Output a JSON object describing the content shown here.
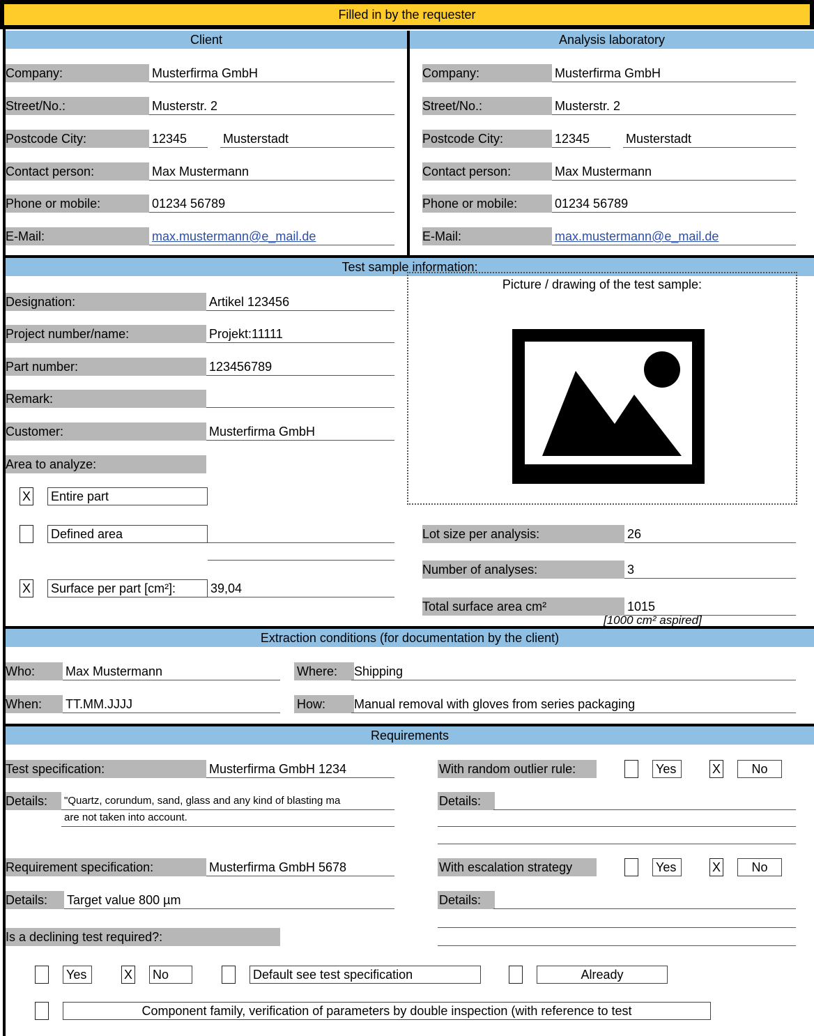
{
  "header": {
    "title": "Filled in by the requester"
  },
  "client": {
    "title": "Client",
    "company_label": "Company:",
    "company": "Musterfirma GmbH",
    "street_label": "Street/No.:",
    "street": "Musterstr. 2",
    "postcode_label": "Postcode City:",
    "postcode": "12345",
    "city": "Musterstadt",
    "contact_label": "Contact person:",
    "contact": "Max Mustermann",
    "phone_label": "Phone or mobile:",
    "phone": "01234 56789",
    "email_label": "E-Mail:",
    "email": "max.mustermann@e_mail.de"
  },
  "lab": {
    "title": "Analysis laboratory",
    "company_label": "Company:",
    "company": "Musterfirma GmbH",
    "street_label": "Street/No.:",
    "street": "Musterstr. 2",
    "postcode_label": "Postcode City:",
    "postcode": "12345",
    "city": "Musterstadt",
    "contact_label": "Contact person:",
    "contact": "Max Mustermann",
    "phone_label": "Phone or mobile:",
    "phone": "01234 56789",
    "email_label": "E-Mail:",
    "email": "max.mustermann@e_mail.de"
  },
  "sample": {
    "title": "Test sample information:",
    "designation_label": "Designation:",
    "designation": "Artikel 123456",
    "project_label": "Project number/name:",
    "project": "Projekt:11111",
    "part_label": "Part number:",
    "part": "123456789",
    "remark_label": "Remark:",
    "remark": "",
    "customer_label": "Customer:",
    "customer": "Musterfirma GmbH",
    "area_label": "Area to analyze:",
    "entire_check": "X",
    "entire_label": "Entire part",
    "defined_check": "",
    "defined_label": "Defined area",
    "surface_check": "X",
    "surface_label": "Surface per part [cm²]:",
    "surface_value": "39,04",
    "picture_title": "Picture / drawing of the test sample:",
    "lot_label": "Lot size per analysis:",
    "lot": "26",
    "analyses_label": "Number of analyses:",
    "analyses": "3",
    "total_label": "Total surface area cm²",
    "total": "1015",
    "aspired_note": "[1000 cm² aspired]"
  },
  "extraction": {
    "title": "Extraction conditions (for documentation by the client)",
    "who_label": "Who:",
    "who": "Max Mustermann",
    "where_label": "Where:",
    "where": "Shipping",
    "when_label": "When:",
    "when": "TT.MM.JJJJ",
    "how_label": "How:",
    "how": "Manual removal with gloves from series packaging"
  },
  "requirements": {
    "title": "Requirements",
    "test_spec_label": "Test specification:",
    "test_spec": "Musterfirma GmbH  1234",
    "details_label": "Details:",
    "test_details_1": "\"Quartz, corundum, sand, glass and any kind of blasting ma",
    "test_details_2": "are not taken into account.",
    "outlier_label": "With random outlier rule:",
    "outlier_yes_check": "",
    "yes_label": "Yes",
    "outlier_no_check": "X",
    "no_label": "No",
    "req_spec_label": "Requirement specification:",
    "req_spec": "Musterfirma GmbH 5678",
    "req_details": "Target value 800 µm",
    "escalation_label": "With escalation strategy",
    "esc_yes_check": "",
    "esc_no_check": "X",
    "declining_label": "Is a declining test required?:",
    "decl_yes_check": "",
    "decl_no_check": "X",
    "default_check": "",
    "default_label": "Default see test specification",
    "already_check": "",
    "already_label": "Already",
    "family_check": "",
    "family_label": "Component family, verification of parameters by double inspection (with reference to test"
  }
}
